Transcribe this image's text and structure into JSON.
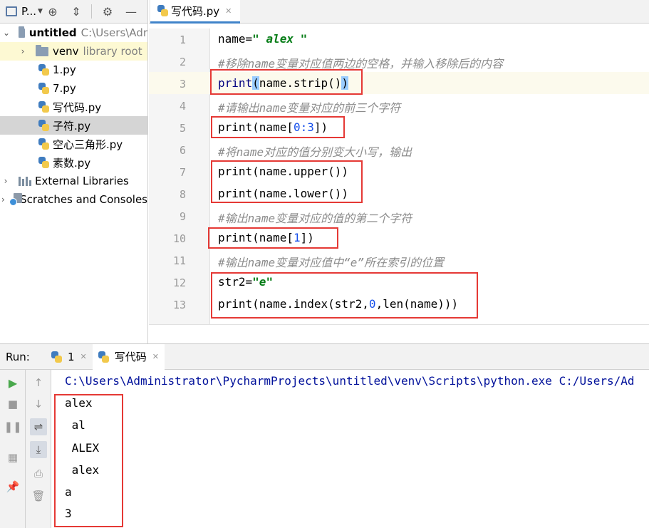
{
  "project_panel": {
    "title": "P...",
    "tree": [
      {
        "label": "untitled",
        "hint": "C:\\Users\\Adr"
      },
      {
        "label": "venv",
        "hint": "library root"
      },
      {
        "label": "1.py"
      },
      {
        "label": "7.py"
      },
      {
        "label": "写代码.py"
      },
      {
        "label": "子符.py"
      },
      {
        "label": "空心三角形.py"
      },
      {
        "label": "素数.py"
      },
      {
        "label": "External Libraries"
      },
      {
        "label": "Scratches and Consoles"
      }
    ]
  },
  "editor": {
    "tab_label": "写代码.py",
    "line_numbers": [
      "1",
      "2",
      "3",
      "4",
      "5",
      "6",
      "7",
      "8",
      "9",
      "10",
      "11",
      "12",
      "13"
    ],
    "lines": {
      "l1_a": "name=",
      "l1_str": "\" alex \"",
      "l2": "#移除name变量对应值两边的空格，并输入移除后的内容",
      "l3_a": "print",
      "l3_b": "(",
      "l3_c": "name.strip()",
      "l3_d": ")",
      "l4": "#请输出name变量对应的前三个字符",
      "l5_a": "print(name[",
      "l5_num": "0:3",
      "l5_b": "])",
      "l6": "#将name对应的值分别变大小写，输出",
      "l7": "print(name.upper())",
      "l8": "print(name.lower())",
      "l9": "#输出name变量对应的值的第二个字符",
      "l10_a": "print(name[",
      "l10_num": "1",
      "l10_b": "])",
      "l11": "#输出name变量对应值中“e”所在索引的位置",
      "l12_a": "str2=",
      "l12_str": "\"e\"",
      "l13_a": "print(name.index(str2,",
      "l13_num": "0",
      "l13_b": ",len(name)))"
    }
  },
  "run_panel": {
    "label": "Run:",
    "tabs": [
      {
        "label": "1"
      },
      {
        "label": "写代码"
      }
    ],
    "command": "C:\\Users\\Administrator\\PycharmProjects\\untitled\\venv\\Scripts\\python.exe C:/Users/Ad",
    "output": [
      "alex",
      " al",
      " ALEX",
      " alex",
      "a",
      "3"
    ]
  }
}
